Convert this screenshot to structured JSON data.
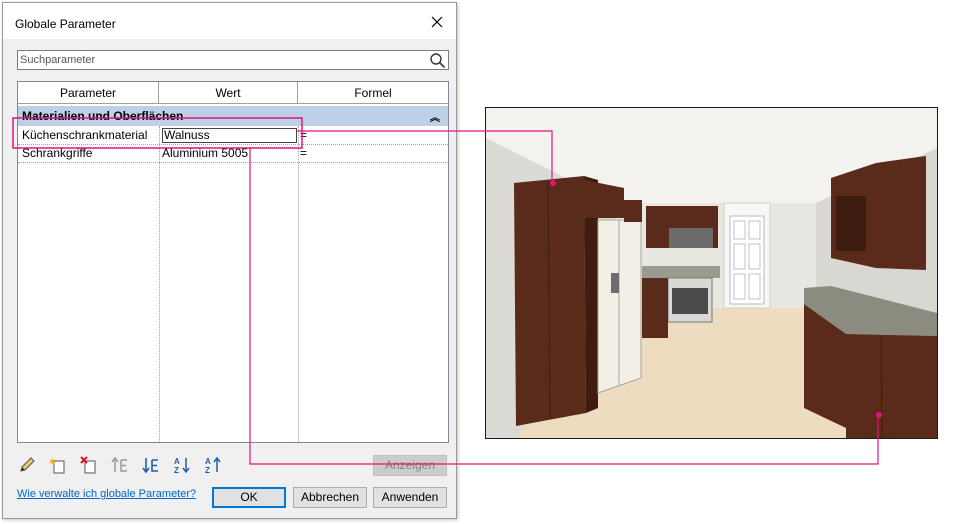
{
  "dialog": {
    "title": "Globale Parameter",
    "search": {
      "value": "",
      "placeholder": "Suchparameter"
    },
    "columns": [
      "Parameter",
      "Wert",
      "Formel"
    ],
    "group": {
      "label": "Materialien und Oberflächen"
    },
    "rows": [
      {
        "parameter": "Küchenschrankmaterial",
        "value": "Walnuss",
        "formula": "="
      },
      {
        "parameter": "Schrankgriffe",
        "value": "Aluminium 5005",
        "formula": "="
      }
    ],
    "toolbar_icons": [
      "edit-pencil-icon",
      "new-parameter-icon",
      "delete-parameter-icon",
      "move-up-icon",
      "move-down-icon",
      "sort-ascending-icon",
      "sort-descending-icon"
    ],
    "show_button": "Anzeigen",
    "help_link": "Wie verwalte ich globale Parameter?",
    "ok_button": "OK",
    "cancel_button": "Abbrechen",
    "apply_button": "Anwenden"
  },
  "colors": {
    "callout": "#e0157a",
    "group_header": "#bdd0e7",
    "link": "#0066cc"
  }
}
